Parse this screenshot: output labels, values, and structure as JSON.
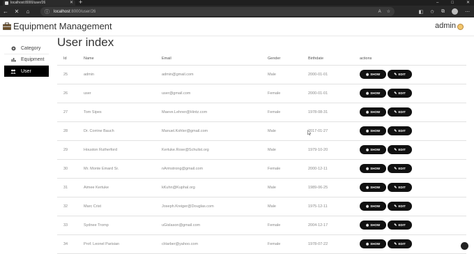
{
  "browser": {
    "tab_title": "localhost:8000/user/26",
    "new_tab_icon": "plus-icon",
    "address_host": "localhost",
    "address_path": ":8000/user/26",
    "window_controls": [
      "–",
      "□",
      "✕"
    ]
  },
  "app": {
    "title": "Equipment Management",
    "user_name": "admin"
  },
  "sidebar": {
    "items": [
      {
        "label": "Category",
        "icon": "tag-icon",
        "active": false
      },
      {
        "label": "Equipment",
        "icon": "chart-icon",
        "active": false
      },
      {
        "label": "User",
        "icon": "users-icon",
        "active": true
      }
    ]
  },
  "main": {
    "title": "User index",
    "columns": [
      "Id",
      "Name",
      "Email",
      "Gender",
      "Birthdate",
      "actions"
    ],
    "show_label": "SHOW",
    "edit_label": "EDIT",
    "rows": [
      {
        "id": "25",
        "name": "admin",
        "email": "admin@gmail.com",
        "gender": "Male",
        "birthdate": "2000-01-01"
      },
      {
        "id": "26",
        "name": "user",
        "email": "user@gmail.com",
        "gender": "Female",
        "birthdate": "2000-01-01"
      },
      {
        "id": "27",
        "name": "Tom Sipes",
        "email": "Maeve.Lehner@Hintz.com",
        "gender": "Female",
        "birthdate": "1978-08-31"
      },
      {
        "id": "28",
        "name": "Dr. Corrine Bauch",
        "email": "Manuel.Kohler@gmail.com",
        "gender": "Male",
        "birthdate": "2017-01-27"
      },
      {
        "id": "29",
        "name": "Houston Rutherford",
        "email": "Kertuke.Rose@Schulist.org",
        "gender": "Male",
        "birthdate": "1979-10-20"
      },
      {
        "id": "30",
        "name": "Mr. Monte Emard Sr.",
        "email": "nArmstrong@gmail.com",
        "gender": "Female",
        "birthdate": "2000-12-11"
      },
      {
        "id": "31",
        "name": "Aimee Kertuke",
        "email": "kKuhn@Kuphal.org",
        "gender": "Male",
        "birthdate": "1989-06-25"
      },
      {
        "id": "32",
        "name": "Marc Crist",
        "email": "Joseph.Kreiger@Douglas.com",
        "gender": "Male",
        "birthdate": "1975-12-11"
      },
      {
        "id": "33",
        "name": "Sydnee Tromp",
        "email": "uGislason@gmail.com",
        "gender": "Female",
        "birthdate": "2004-12-17"
      },
      {
        "id": "34",
        "name": "Prof. Leonel Parisian",
        "email": "cHarber@yahoo.com",
        "gender": "Female",
        "birthdate": "1978-07-22"
      }
    ]
  }
}
